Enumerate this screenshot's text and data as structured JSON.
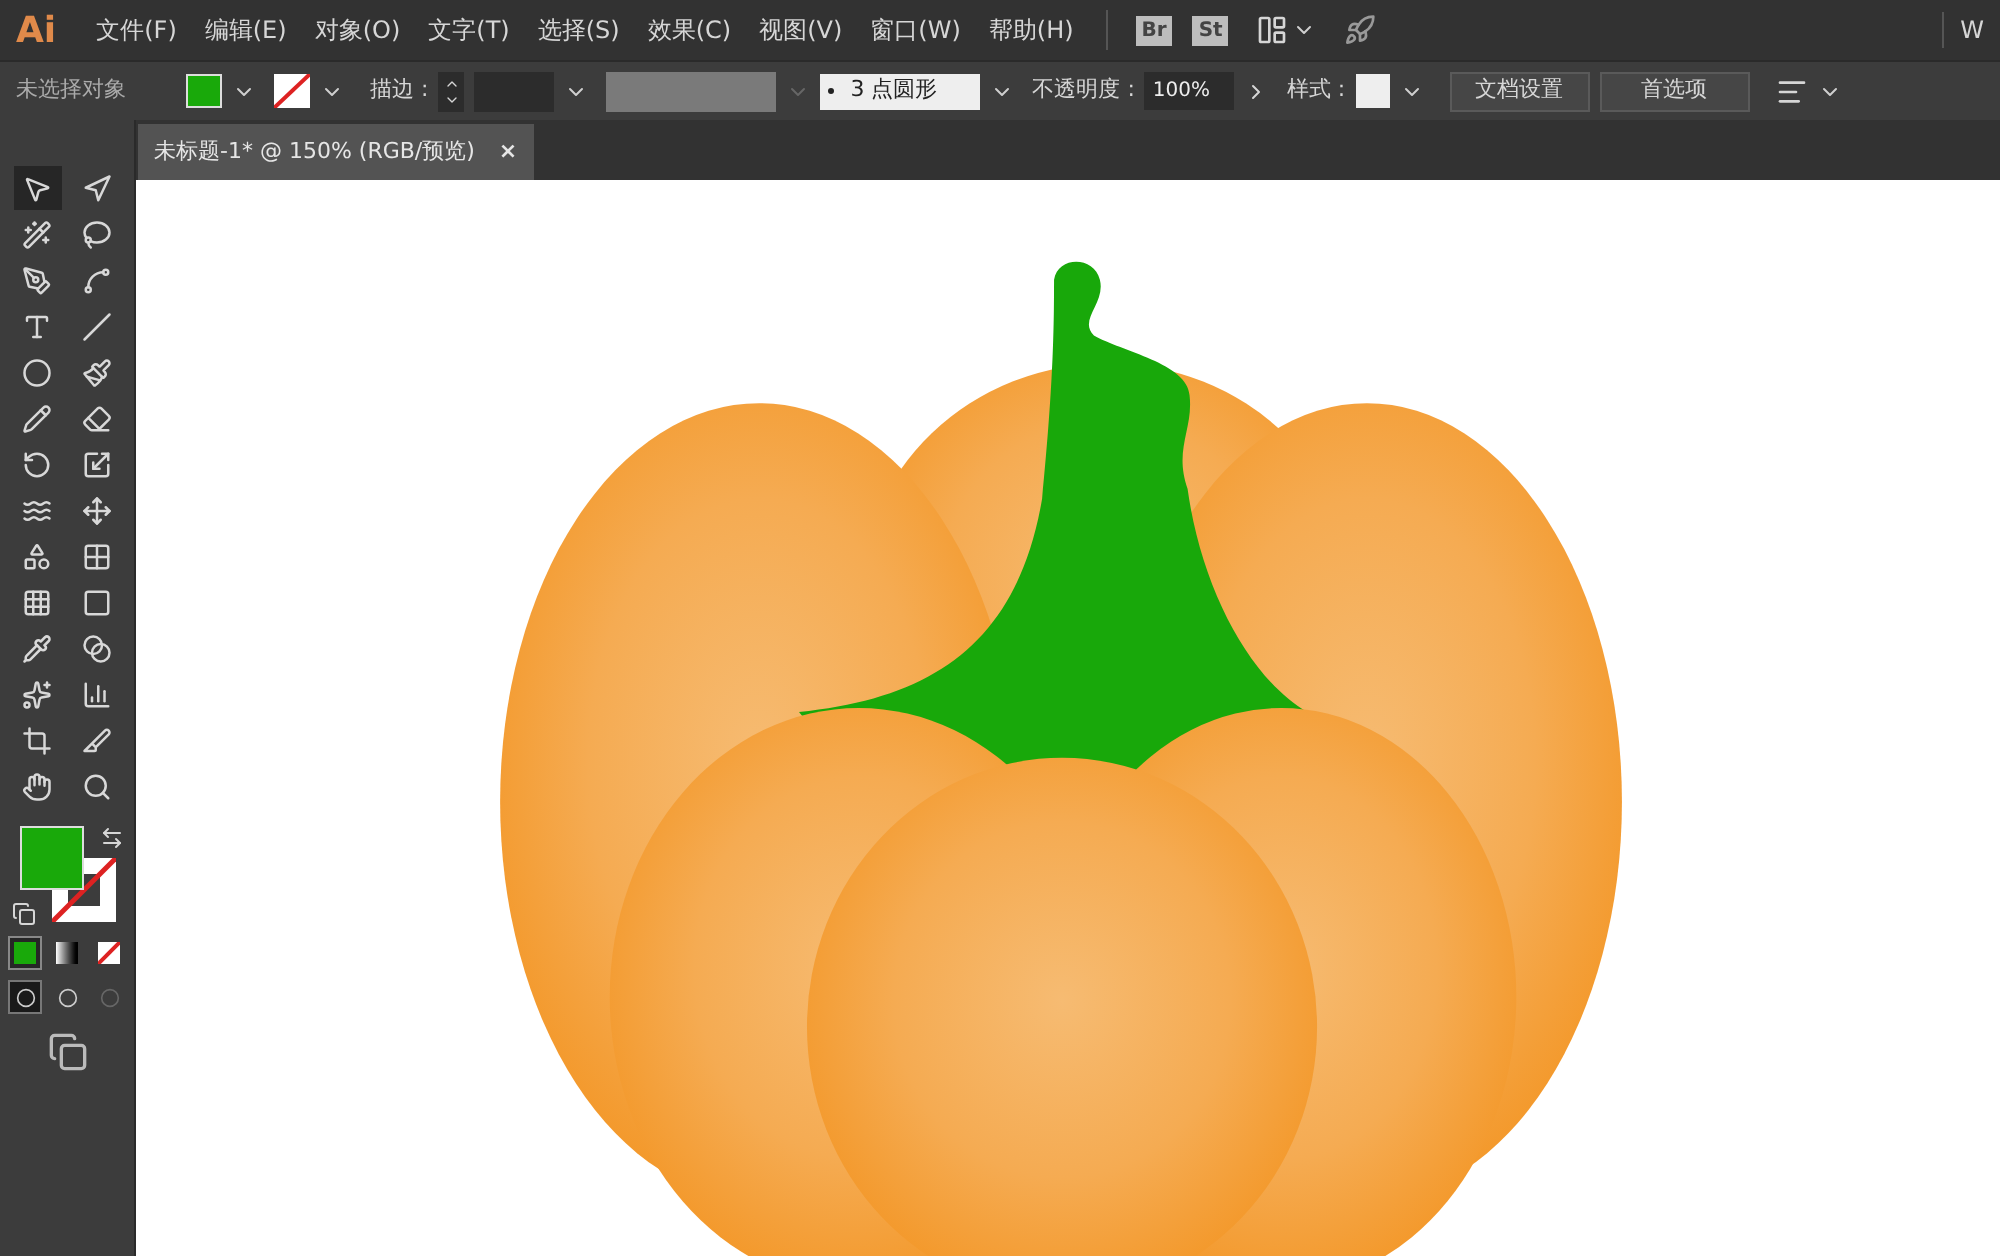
{
  "app": {
    "logo": "Ai",
    "menus": [
      "文件(F)",
      "编辑(E)",
      "对象(O)",
      "文字(T)",
      "选择(S)",
      "效果(C)",
      "视图(V)",
      "窗口(W)",
      "帮助(H)"
    ],
    "bridge": "Br",
    "stock": "St",
    "workspace": "W"
  },
  "control_bar": {
    "selection": "未选择对象",
    "stroke_label": "描边 :",
    "brush": "3 点圆形",
    "opacity_label": "不透明度 :",
    "opacity": "100%",
    "style_label": "样式 :",
    "doc_setup": "文档设置",
    "preferences": "首选项"
  },
  "document_tab": {
    "title": "未标题-1* @ 150% (RGB/预览)",
    "close": "×"
  },
  "tools": [
    {
      "selected": true
    },
    {
      "selected": false
    },
    {
      "selected": false
    },
    {
      "selected": false
    },
    {
      "selected": false
    },
    {
      "selected": false
    },
    {
      "selected": false
    },
    {
      "selected": false
    },
    {
      "selected": false
    },
    {
      "selected": false
    },
    {
      "selected": false
    },
    {
      "selected": false
    },
    {
      "selected": false
    },
    {
      "selected": false
    },
    {
      "selected": false
    },
    {
      "selected": false
    },
    {
      "selected": false
    },
    {
      "selected": false
    },
    {
      "selected": false
    },
    {
      "selected": false
    },
    {
      "selected": false
    },
    {
      "selected": false
    },
    {
      "selected": false
    },
    {
      "selected": false
    },
    {
      "selected": false
    },
    {
      "selected": false
    },
    {
      "selected": false
    },
    {
      "selected": false
    }
  ],
  "color_modes": [
    {
      "kind": "color",
      "selected": true
    },
    {
      "kind": "gradient",
      "selected": false
    },
    {
      "kind": "none",
      "selected": false
    }
  ],
  "draw_modes": [
    {
      "selected": true
    },
    {
      "selected": false
    },
    {
      "selected": false
    }
  ]
}
